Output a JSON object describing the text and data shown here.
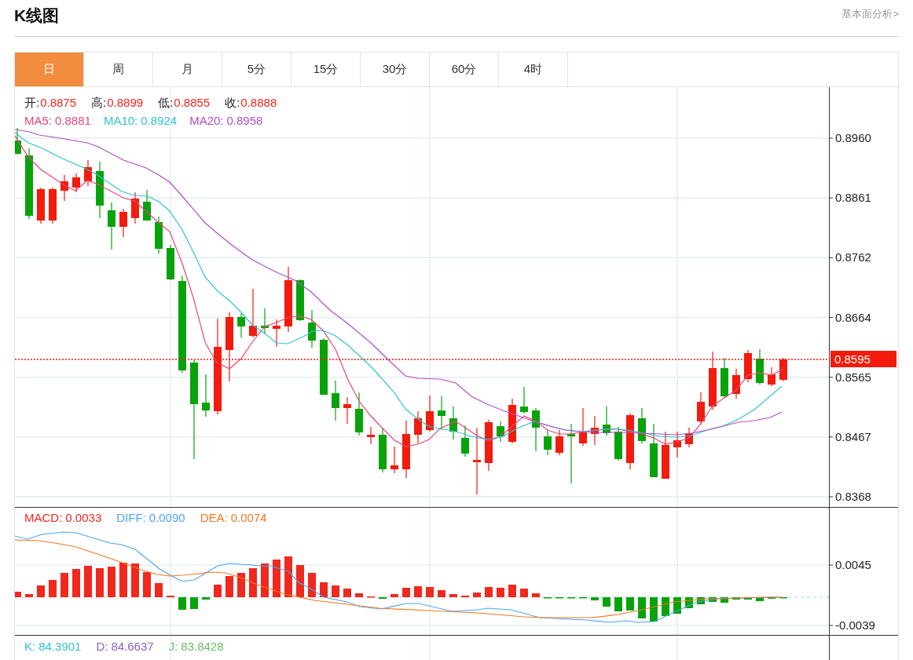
{
  "header": {
    "title": "K线图",
    "link": "基本面分析>"
  },
  "tabs": [
    {
      "label": "日",
      "selected": true
    },
    {
      "label": "周",
      "selected": false
    },
    {
      "label": "月",
      "selected": false
    },
    {
      "label": "5分",
      "selected": false
    },
    {
      "label": "15分",
      "selected": false
    },
    {
      "label": "30分",
      "selected": false
    },
    {
      "label": "60分",
      "selected": false
    },
    {
      "label": "4时",
      "selected": false
    }
  ],
  "price_panel": {
    "ohlc": [
      {
        "label": "开:",
        "value": "0.8875"
      },
      {
        "label": "高:",
        "value": "0.8899"
      },
      {
        "label": "低:",
        "value": "0.8855"
      },
      {
        "label": "收:",
        "value": "0.8888"
      }
    ],
    "moving_averages": [
      {
        "label": "MA5:",
        "value": "0.8881",
        "color": "#e8467c"
      },
      {
        "label": "MA10:",
        "value": "0.8924",
        "color": "#2fc3d8"
      },
      {
        "label": "MA20:",
        "value": "0.8958",
        "color": "#b14ec5"
      }
    ],
    "axis_labels": [
      "0.8960",
      "0.8861",
      "0.8762",
      "0.8664",
      "0.8565",
      "0.8467",
      "0.8368"
    ],
    "current_price": "0.8595"
  },
  "macd_panel": {
    "indicators": [
      {
        "label": "MACD:",
        "value": "0.0033",
        "color": "#f0281e"
      },
      {
        "label": "DIFF:",
        "value": "0.0090",
        "color": "#4aa6f2"
      },
      {
        "label": "DEA:",
        "value": "0.0074",
        "color": "#f5781e"
      }
    ],
    "axis_labels": [
      "0.0045",
      "-0.0039"
    ]
  },
  "kdj_panel": {
    "indicators": [
      {
        "label": "K:",
        "value": "84.3901",
        "color": "#33c0d8"
      },
      {
        "label": "D:",
        "value": "84.6637",
        "color": "#8e5fc8"
      },
      {
        "label": "J:",
        "value": "83.8428",
        "color": "#68c06a"
      }
    ]
  }
}
